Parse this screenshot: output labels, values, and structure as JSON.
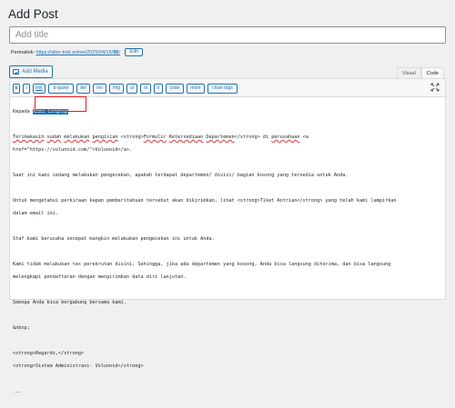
{
  "page": {
    "title": "Add Post"
  },
  "title_field": {
    "placeholder": "Add title"
  },
  "permalink": {
    "label": "Permalink:",
    "url_prefix": "https://alter-trial.online/2025/04/16/",
    "url_slug": "96",
    "url_suffix": "/",
    "edit_label": "Edit"
  },
  "media": {
    "add_label": "Add Media",
    "icon": "media-icon"
  },
  "tabs": {
    "visual": "Visual",
    "code": "Code",
    "active": "Code"
  },
  "toolbar": {
    "buttons": [
      "b",
      "i",
      "link",
      "b-quote",
      "del",
      "ins",
      "img",
      "ul",
      "ol",
      "li",
      "code",
      "more",
      "close tags"
    ],
    "fullscreen_icon": "fullscreen-icon"
  },
  "content": {
    "line1_prefix": "Kepada ",
    "line1_selected": "Nama Lengkap",
    "line2_w1": "Terimakasih",
    "line2_w2": "sudah",
    "line2_w3": "melakukan",
    "line2_w4": "pengisian",
    "line2_mid": " <strong>",
    "line2_w5": "Formulir",
    "line2_w6": "Ketersediaan",
    "line2_w7": "Departemen",
    "line2_end": "</strong> di ",
    "line2_w8": "perusahaan",
    "line2_tail": " <a",
    "line3": "href=\"https://volunoid.com/\">Volunoid</a>.",
    "line4": "Saat ini kami sedang melakukan pengecekan, apakah terdapat departemen/ divisi/ bagian kosong yang tersedia untuk Anda.",
    "line5": "Untuk mengetahui perkiraan kapan pemberitahuan tersebut akan dikirimkan, lihat <strong>Tiket Antrian</strong> yang telah kami lampirkan",
    "line6": "dalam email ini.",
    "line7": "Staf kami berusaha secepat mungkin melakukan pengecekan ini untuk Anda.",
    "line8": "Kami tidak melakukan tes perekrutan disini. Sehingga, jika ada departemen yang kosong, Anda bisa langsung diterima, dan bisa langsung",
    "line9": "melengkapi pendaftaran dengan mengirimkan data diri lanjutan.",
    "line10": "Semoga Anda bisa bergabung bersama kami.",
    "line11": "&nbsp;",
    "line12": "<strong>Regards,</strong>",
    "line13": "<strong>Sistem Administrasi- Volunoid</strong>",
    "line14": "..."
  }
}
